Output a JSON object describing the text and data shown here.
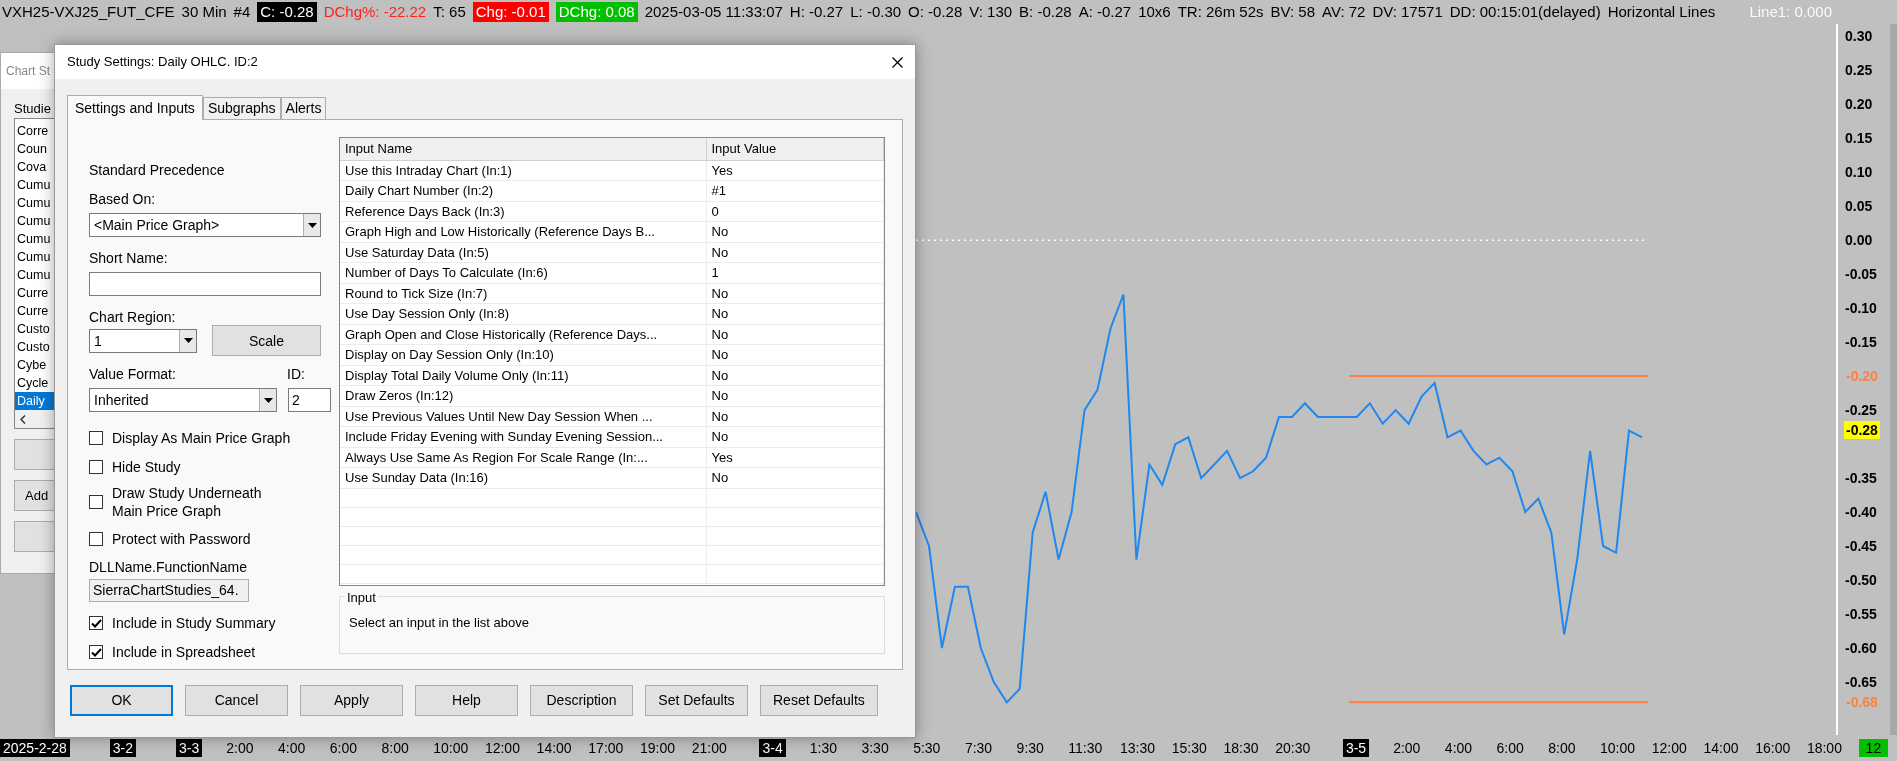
{
  "chart_header": {
    "items": [
      {
        "text": "VXH25-VXJ25_FUT_CFE",
        "kind": "text"
      },
      {
        "text": "30 Min",
        "kind": "text"
      },
      {
        "text": "#4",
        "kind": "text"
      },
      {
        "text": "C: -0.28",
        "kind": "boxed"
      },
      {
        "text": "DChg%: -22.22",
        "kind": "negative"
      },
      {
        "text": "T: 65",
        "kind": "text"
      },
      {
        "text": "Chg: -0.01",
        "kind": "boxed_negative"
      },
      {
        "text": "DChg: 0.08",
        "kind": "boxed_positive"
      },
      {
        "text": "2025-03-05 11:33:07",
        "kind": "text"
      },
      {
        "text": "H: -0.27",
        "kind": "text"
      },
      {
        "text": "L: -0.30",
        "kind": "text"
      },
      {
        "text": "O: -0.28",
        "kind": "text"
      },
      {
        "text": "V: 130",
        "kind": "text"
      },
      {
        "text": "B: -0.28",
        "kind": "text"
      },
      {
        "text": "A: -0.27",
        "kind": "text"
      },
      {
        "text": "10x6",
        "kind": "text"
      },
      {
        "text": "TR: 26m 52s",
        "kind": "text"
      },
      {
        "text": "BV: 58",
        "kind": "text"
      },
      {
        "text": "AV: 72",
        "kind": "text"
      },
      {
        "text": "DV: 17571",
        "kind": "text"
      },
      {
        "text": "DD: 00:15:01(delayed)",
        "kind": "text"
      },
      {
        "text": "Horizontal Lines",
        "kind": "text"
      },
      {
        "text": "Line1: 0.000",
        "kind": "faint"
      }
    ]
  },
  "chart": {
    "price_labels": [
      "0.30",
      "0.25",
      "0.20",
      "0.15",
      "0.10",
      "0.05",
      "0.00",
      "-0.05",
      "-0.10",
      "-0.15",
      "-0.25",
      "-0.35",
      "-0.40",
      "-0.45",
      "-0.50",
      "-0.55",
      "-0.60",
      "-0.65"
    ],
    "markers": [
      {
        "kind": "line",
        "label": "-0.20",
        "color": "#ff7f3f"
      },
      {
        "kind": "last",
        "label": "-0.28",
        "color": "#ffff00"
      },
      {
        "kind": "line",
        "label": "-0.68",
        "color": "#ff7f3f"
      }
    ]
  },
  "time_axis": {
    "labels": [
      {
        "text": "2025-2-28",
        "kind": "date"
      },
      {
        "text": "3-2",
        "kind": "date"
      },
      {
        "text": "3-3",
        "kind": "date"
      },
      {
        "text": "2:00",
        "kind": "time"
      },
      {
        "text": "4:00",
        "kind": "time"
      },
      {
        "text": "6:00",
        "kind": "time"
      },
      {
        "text": "8:00",
        "kind": "time"
      },
      {
        "text": "10:00",
        "kind": "time"
      },
      {
        "text": "12:00",
        "kind": "time"
      },
      {
        "text": "14:00",
        "kind": "time"
      },
      {
        "text": "17:00",
        "kind": "time"
      },
      {
        "text": "19:00",
        "kind": "time"
      },
      {
        "text": "21:00",
        "kind": "time"
      },
      {
        "text": "3-4",
        "kind": "date"
      },
      {
        "text": "1:30",
        "kind": "time"
      },
      {
        "text": "3:30",
        "kind": "time"
      },
      {
        "text": "5:30",
        "kind": "time"
      },
      {
        "text": "7:30",
        "kind": "time"
      },
      {
        "text": "9:30",
        "kind": "time"
      },
      {
        "text": "11:30",
        "kind": "time"
      },
      {
        "text": "13:30",
        "kind": "time"
      },
      {
        "text": "15:30",
        "kind": "time"
      },
      {
        "text": "18:30",
        "kind": "time"
      },
      {
        "text": "20:30",
        "kind": "time"
      },
      {
        "text": "3-5",
        "kind": "date"
      },
      {
        "text": "2:00",
        "kind": "time"
      },
      {
        "text": "4:00",
        "kind": "time"
      },
      {
        "text": "6:00",
        "kind": "time"
      },
      {
        "text": "8:00",
        "kind": "time"
      },
      {
        "text": "10:00",
        "kind": "time"
      },
      {
        "text": "12:00",
        "kind": "time"
      },
      {
        "text": "14:00",
        "kind": "time"
      },
      {
        "text": "16:00",
        "kind": "time"
      },
      {
        "text": "18:00",
        "kind": "time"
      }
    ],
    "bar_count": "12"
  },
  "background_dialog": {
    "title": "Chart St",
    "studies_label": "Studie",
    "studies": [
      {
        "label": "Corre",
        "selected": false
      },
      {
        "label": "Coun",
        "selected": false
      },
      {
        "label": "Cova",
        "selected": false
      },
      {
        "label": "Cumu",
        "selected": false
      },
      {
        "label": "Cumu",
        "selected": false
      },
      {
        "label": "Cumu",
        "selected": false
      },
      {
        "label": "Cumu",
        "selected": false
      },
      {
        "label": "Cumu",
        "selected": false
      },
      {
        "label": "Cumu",
        "selected": false
      },
      {
        "label": "Curre",
        "selected": false
      },
      {
        "label": "Curre",
        "selected": false
      },
      {
        "label": "Custo",
        "selected": false
      },
      {
        "label": "Custo",
        "selected": false
      },
      {
        "label": "Cybe",
        "selected": false
      },
      {
        "label": "Cycle",
        "selected": false
      },
      {
        "label": "Daily",
        "selected": true
      }
    ],
    "buttons": [
      {
        "kind": "blank"
      },
      {
        "kind": "text",
        "label": "Add"
      },
      {
        "kind": "blank"
      }
    ]
  },
  "dialog": {
    "title": "Study Settings: Daily OHLC. ID:2",
    "tabs": [
      {
        "label": "Settings and Inputs",
        "selected": true
      },
      {
        "label": "Subgraphs",
        "selected": false
      },
      {
        "label": "Alerts",
        "selected": false
      }
    ],
    "standard_precedence": "Standard Precedence",
    "based_on": {
      "label": "Based On:",
      "value": "<Main Price Graph>"
    },
    "short_name": {
      "label": "Short Name:"
    },
    "chart_region": {
      "label": "Chart Region:",
      "value": "1"
    },
    "scale_button": "Scale",
    "value_format": {
      "label": "Value Format:",
      "value": "Inherited"
    },
    "id": {
      "label": "ID:",
      "value": "2"
    },
    "options_top": [
      {
        "label": "Display As Main Price Graph",
        "checked": false
      },
      {
        "label": "Hide Study",
        "checked": false
      },
      {
        "label": "Draw Study Underneath\nMain Price Graph",
        "checked": false
      },
      {
        "label": "Protect with Password",
        "checked": false
      }
    ],
    "dll": {
      "label": "DLLName.FunctionName",
      "value": "SierraChartStudies_64."
    },
    "options_bottom": [
      {
        "label": "Include in Study Summary",
        "checked": true
      },
      {
        "label": "Include in Spreadsheet",
        "checked": true
      }
    ],
    "inputs_table": {
      "columns": [
        "Input Name",
        "Input Value"
      ],
      "rows": [
        {
          "name": "Use this Intraday Chart   (In:1)",
          "value": "Yes"
        },
        {
          "name": "Daily Chart Number   (In:2)",
          "value": "#1"
        },
        {
          "name": "Reference Days Back   (In:3)",
          "value": "0"
        },
        {
          "name": "Graph High and Low Historically (Reference Days B...",
          "value": "No"
        },
        {
          "name": "Use Saturday Data   (In:5)",
          "value": "No"
        },
        {
          "name": "Number of Days To Calculate   (In:6)",
          "value": "1"
        },
        {
          "name": "Round to Tick Size   (In:7)",
          "value": "No"
        },
        {
          "name": "Use Day Session Only   (In:8)",
          "value": "No"
        },
        {
          "name": "Graph Open and Close Historically (Reference Days...",
          "value": "No"
        },
        {
          "name": "Display on Day Session Only   (In:10)",
          "value": "No"
        },
        {
          "name": "Display Total Daily Volume Only   (In:11)",
          "value": "No"
        },
        {
          "name": "Draw Zeros   (In:12)",
          "value": "No"
        },
        {
          "name": "Use Previous Values Until New Day Session When ...",
          "value": "No"
        },
        {
          "name": "Include Friday Evening with Sunday Evening Session...",
          "value": "No"
        },
        {
          "name": "Always Use Same As Region For Scale Range   (In:...",
          "value": "Yes"
        },
        {
          "name": "Use Sunday Data   (In:16)",
          "value": "No"
        }
      ]
    },
    "input_group": {
      "title": "Input",
      "text": "Select an input in the list above"
    },
    "buttons": [
      {
        "label": "OK",
        "default": true
      },
      {
        "label": "Cancel",
        "default": false
      },
      {
        "label": "Apply",
        "default": false
      },
      {
        "label": "Help",
        "default": false
      },
      {
        "label": "Description",
        "default": false
      },
      {
        "label": "Set Defaults",
        "default": false
      },
      {
        "label": "Reset Defaults",
        "default": false
      }
    ]
  }
}
